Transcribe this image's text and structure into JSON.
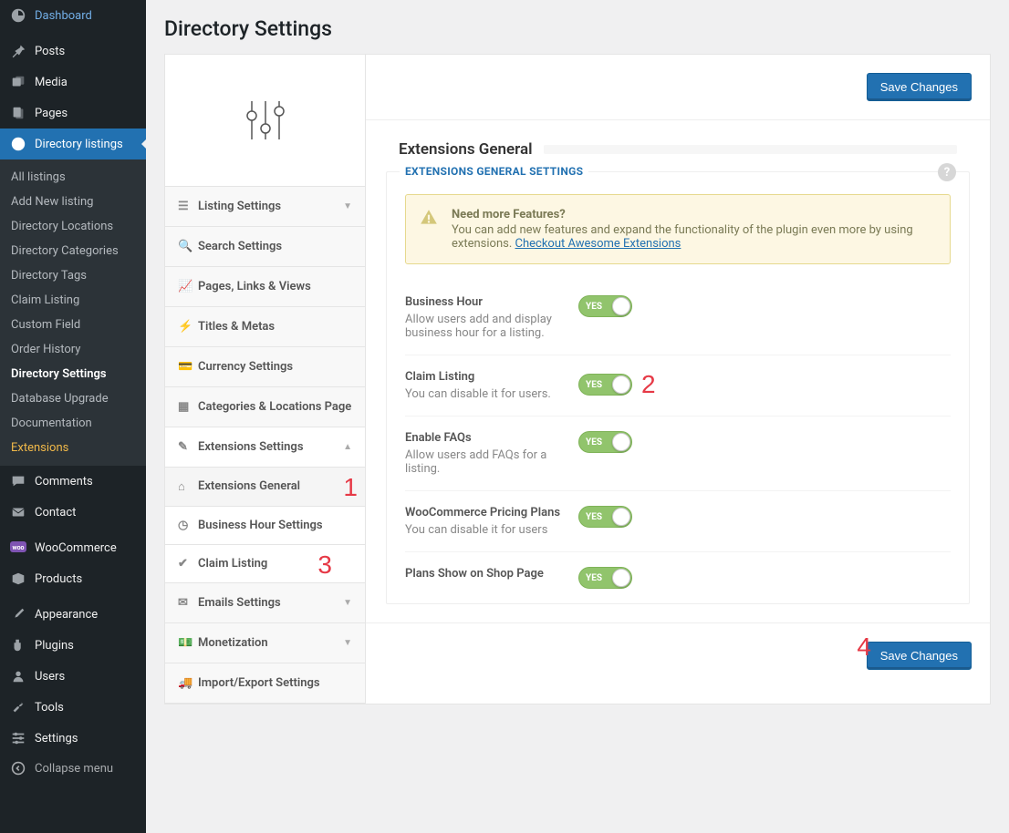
{
  "sidebar": {
    "dashboard": "Dashboard",
    "posts": "Posts",
    "media": "Media",
    "pages": "Pages",
    "directory_listings": "Directory listings",
    "submenu": {
      "all_listings": "All listings",
      "add_new": "Add New listing",
      "locations": "Directory Locations",
      "categories": "Directory Categories",
      "tags": "Directory Tags",
      "claim": "Claim Listing",
      "custom_field": "Custom Field",
      "order_history": "Order History",
      "directory_settings": "Directory Settings",
      "db_upgrade": "Database Upgrade",
      "documentation": "Documentation",
      "extensions": "Extensions"
    },
    "comments": "Comments",
    "contact": "Contact",
    "woocommerce": "WooCommerce",
    "products": "Products",
    "appearance": "Appearance",
    "plugins": "Plugins",
    "users": "Users",
    "tools": "Tools",
    "settings": "Settings",
    "collapse": "Collapse menu"
  },
  "page_title": "Directory Settings",
  "settings_nav": {
    "listing": "Listing Settings",
    "search": "Search Settings",
    "pages": "Pages, Links & Views",
    "titles": "Titles & Metas",
    "currency": "Currency Settings",
    "catloc": "Categories & Locations Page",
    "extensions": "Extensions Settings",
    "ext_general": "Extensions General",
    "ext_business": "Business Hour Settings",
    "ext_claim": "Claim Listing",
    "emails": "Emails Settings",
    "monetization": "Monetization",
    "import_export": "Import/Export Settings"
  },
  "save_button": "Save Changes",
  "section_title": "Extensions General",
  "panel_legend": "EXTENSIONS GENERAL SETTINGS",
  "notice": {
    "title": "Need more Features?",
    "body": "You can add new features and expand the functionality of the plugin even more by using extensions. ",
    "link": "Checkout Awesome Extensions"
  },
  "toggle_on": "YES",
  "fields": {
    "business_hour": {
      "label": "Business Hour",
      "desc": "Allow users add and display business hour for a listing."
    },
    "claim_listing": {
      "label": "Claim Listing",
      "desc": "You can disable it for users."
    },
    "enable_faqs": {
      "label": "Enable FAQs",
      "desc": "Allow users add FAQs for a listing."
    },
    "woo_pricing": {
      "label": "WooCommerce Pricing Plans",
      "desc": "You can disable it for users"
    },
    "plans_shop": {
      "label": "Plans Show on Shop Page",
      "desc": ""
    }
  },
  "annot": {
    "a1": "1",
    "a2": "2",
    "a3": "3",
    "a4": "4"
  }
}
